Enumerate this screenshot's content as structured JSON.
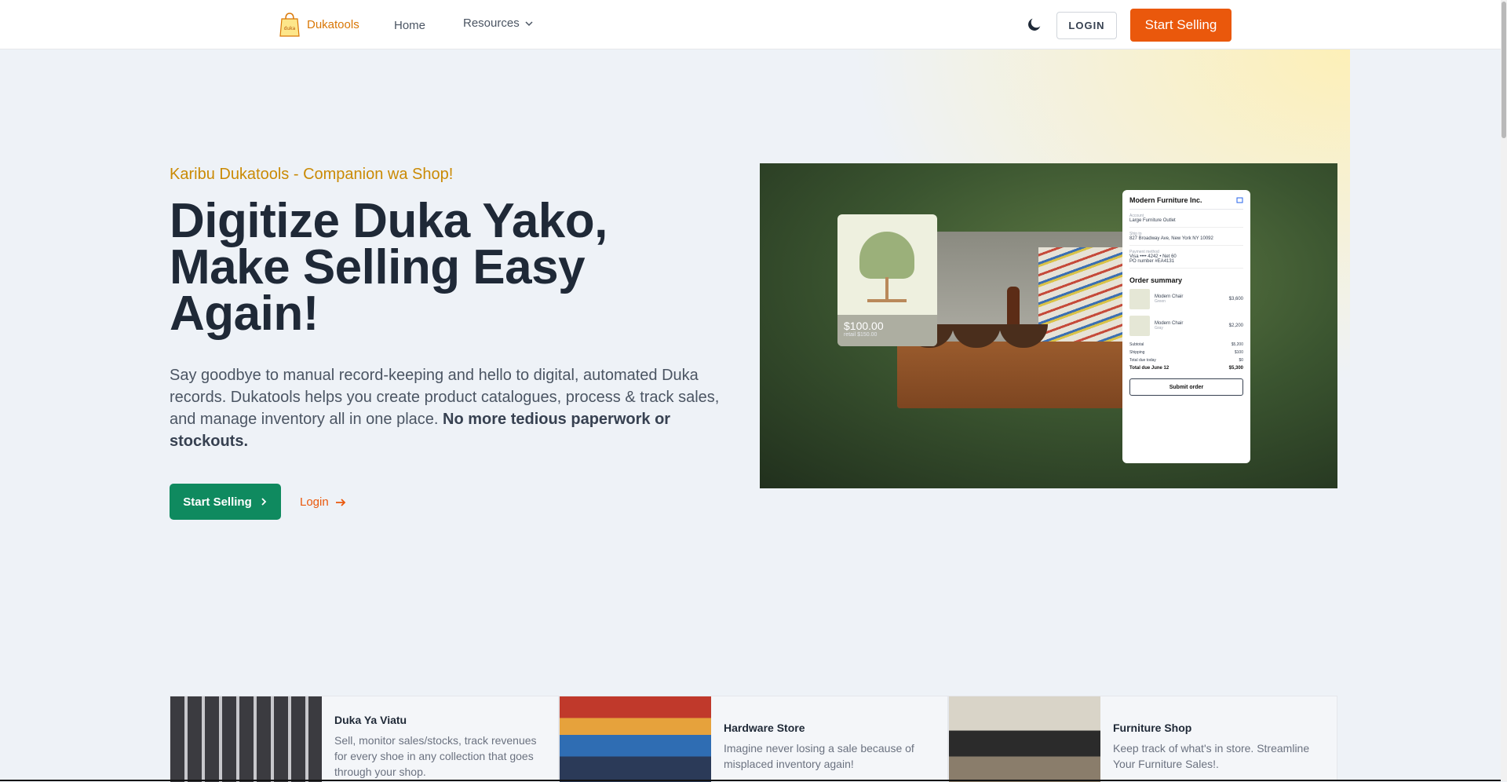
{
  "nav": {
    "brand": "Dukatools",
    "logo_text": "duka",
    "home": "Home",
    "resources": "Resources",
    "login": "LOGIN",
    "start_selling": "Start Selling"
  },
  "hero": {
    "tagline": "Karibu Dukatools - Companion wa Shop!",
    "headline": "Digitize Duka Yako, Make Selling Easy Again!",
    "lead": "Say goodbye to manual record-keeping and hello to digital, automated Duka records. Dukatools helps you create product catalogues, process & track sales, and manage inventory all in one place.",
    "lead_bold": "No more tedious paperwork or stockouts.",
    "cta_primary": "Start Selling",
    "cta_secondary": "Login"
  },
  "hero_image": {
    "product_price": "$100.00",
    "product_retail": "retail $150.00",
    "checkout": {
      "company": "Modern Furniture Inc.",
      "account_label": "Account",
      "account_value": "Large Furniture Outlet",
      "ship_label": "Ship to",
      "ship_value": "827 Broadway Ave, New York NY 10092",
      "payment_label": "Payment method",
      "payment_value": "Visa •••• 4242 • Net 60",
      "po_number": "PO number #EA4131",
      "summary_title": "Order summary",
      "items": [
        {
          "name": "Modern Chair",
          "variant": "Green",
          "price": "$3,600"
        },
        {
          "name": "Modern Chair",
          "variant": "Gray",
          "price": "$2,200"
        }
      ],
      "subtotal_label": "Subtotal",
      "subtotal": "$5,200",
      "shipping_label": "Shipping",
      "shipping": "$100",
      "due_today_label": "Total due today",
      "due_today": "$0",
      "total_label": "Total due June 12",
      "total": "$5,300",
      "submit": "Submit order"
    }
  },
  "cards": [
    {
      "title": "Duka Ya Viatu",
      "desc": "Sell, monitor sales/stocks, track revenues for every shoe in any collection that goes through your shop."
    },
    {
      "title": "Hardware Store",
      "desc": "Imagine never losing a sale because of misplaced inventory again!"
    },
    {
      "title": "Furniture Shop",
      "desc": "Keep track of what's in store. Streamline Your Furniture Sales!."
    }
  ],
  "colors": {
    "accent_orange": "#ea580c",
    "brand_gold": "#d97706",
    "tagline": "#ca8a04",
    "primary_green": "#0f8a5f"
  },
  "icons": [
    "logo-icon",
    "chevron-down-icon",
    "moon-icon",
    "chevron-right-icon",
    "arrow-right-icon",
    "cart-icon"
  ]
}
